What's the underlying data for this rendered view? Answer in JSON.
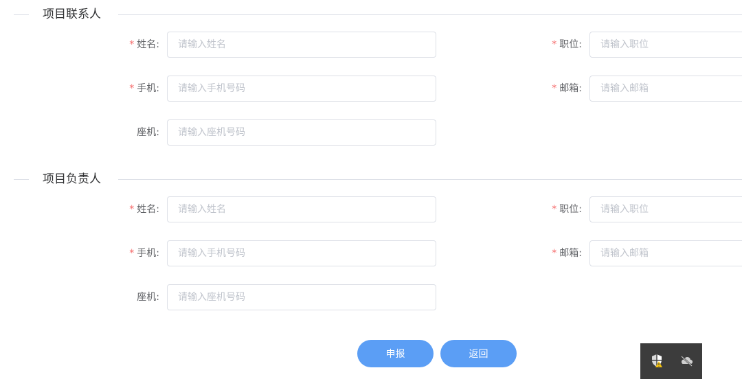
{
  "sections": [
    {
      "title": "项目联系人",
      "fields": {
        "name": {
          "label": "姓名:",
          "required": "*",
          "placeholder": "请输入姓名",
          "value": ""
        },
        "position": {
          "label": "职位:",
          "required": "*",
          "placeholder": "请输入职位",
          "value": ""
        },
        "mobile": {
          "label": "手机:",
          "required": "*",
          "placeholder": "请输入手机号码",
          "value": ""
        },
        "email": {
          "label": "邮箱:",
          "required": "*",
          "placeholder": "请输入邮箱",
          "value": ""
        },
        "landline": {
          "label": "座机:",
          "placeholder": "请输入座机号码",
          "value": ""
        }
      }
    },
    {
      "title": "项目负责人",
      "fields": {
        "name": {
          "label": "姓名:",
          "required": "*",
          "placeholder": "请输入姓名",
          "value": ""
        },
        "position": {
          "label": "职位:",
          "required": "*",
          "placeholder": "请输入职位",
          "value": ""
        },
        "mobile": {
          "label": "手机:",
          "required": "*",
          "placeholder": "请输入手机号码",
          "value": ""
        },
        "email": {
          "label": "邮箱:",
          "required": "*",
          "placeholder": "请输入邮箱",
          "value": ""
        },
        "landline": {
          "label": "座机:",
          "placeholder": "请输入座机号码",
          "value": ""
        }
      }
    }
  ],
  "actions": {
    "submit_label": "申报",
    "back_label": "返回"
  },
  "tray": {
    "icons": [
      "shield-warning-icon",
      "cloud-offline-icon"
    ]
  },
  "colors": {
    "primary_button": "#5b9ef5",
    "required_mark": "#f56c6c",
    "border": "#dcdfe6",
    "placeholder": "#c0c4cc",
    "tray_bg": "#3c3c3c"
  }
}
